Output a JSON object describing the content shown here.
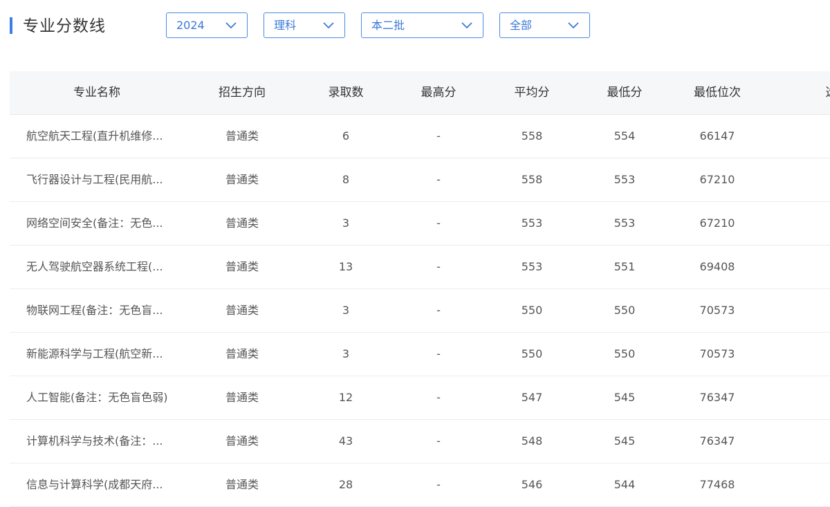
{
  "page": {
    "title": "专业分数线",
    "accent_color": "#3b7ee8"
  },
  "filters": [
    {
      "value": "2024",
      "icon": "chevron-down-icon"
    },
    {
      "value": "理科",
      "icon": "chevron-down-icon"
    },
    {
      "value": "本二批",
      "icon": "chevron-down-icon"
    },
    {
      "value": "全部",
      "icon": "chevron-down-icon"
    }
  ],
  "table": {
    "headers": [
      "专业名称",
      "招生方向",
      "录取数",
      "最高分",
      "平均分",
      "最低分",
      "最低位次",
      "选"
    ],
    "rows": [
      {
        "name": "航空航天工程(直升机维修...",
        "direction": "普通类",
        "admitted": "6",
        "max": "-",
        "avg": "558",
        "min": "554",
        "rank": "66147"
      },
      {
        "name": "飞行器设计与工程(民用航...",
        "direction": "普通类",
        "admitted": "8",
        "max": "-",
        "avg": "558",
        "min": "553",
        "rank": "67210"
      },
      {
        "name": "网络空间安全(备注：无色...",
        "direction": "普通类",
        "admitted": "3",
        "max": "-",
        "avg": "553",
        "min": "553",
        "rank": "67210"
      },
      {
        "name": "无人驾驶航空器系统工程(...",
        "direction": "普通类",
        "admitted": "13",
        "max": "-",
        "avg": "553",
        "min": "551",
        "rank": "69408"
      },
      {
        "name": "物联网工程(备注：无色盲...",
        "direction": "普通类",
        "admitted": "3",
        "max": "-",
        "avg": "550",
        "min": "550",
        "rank": "70573"
      },
      {
        "name": "新能源科学与工程(航空新...",
        "direction": "普通类",
        "admitted": "3",
        "max": "-",
        "avg": "550",
        "min": "550",
        "rank": "70573"
      },
      {
        "name": "人工智能(备注：无色盲色弱)",
        "direction": "普通类",
        "admitted": "12",
        "max": "-",
        "avg": "547",
        "min": "545",
        "rank": "76347"
      },
      {
        "name": "计算机科学与技术(备注：...",
        "direction": "普通类",
        "admitted": "43",
        "max": "-",
        "avg": "548",
        "min": "545",
        "rank": "76347"
      },
      {
        "name": "信息与计算科学(成都天府...",
        "direction": "普通类",
        "admitted": "28",
        "max": "-",
        "avg": "546",
        "min": "544",
        "rank": "77468"
      }
    ]
  }
}
